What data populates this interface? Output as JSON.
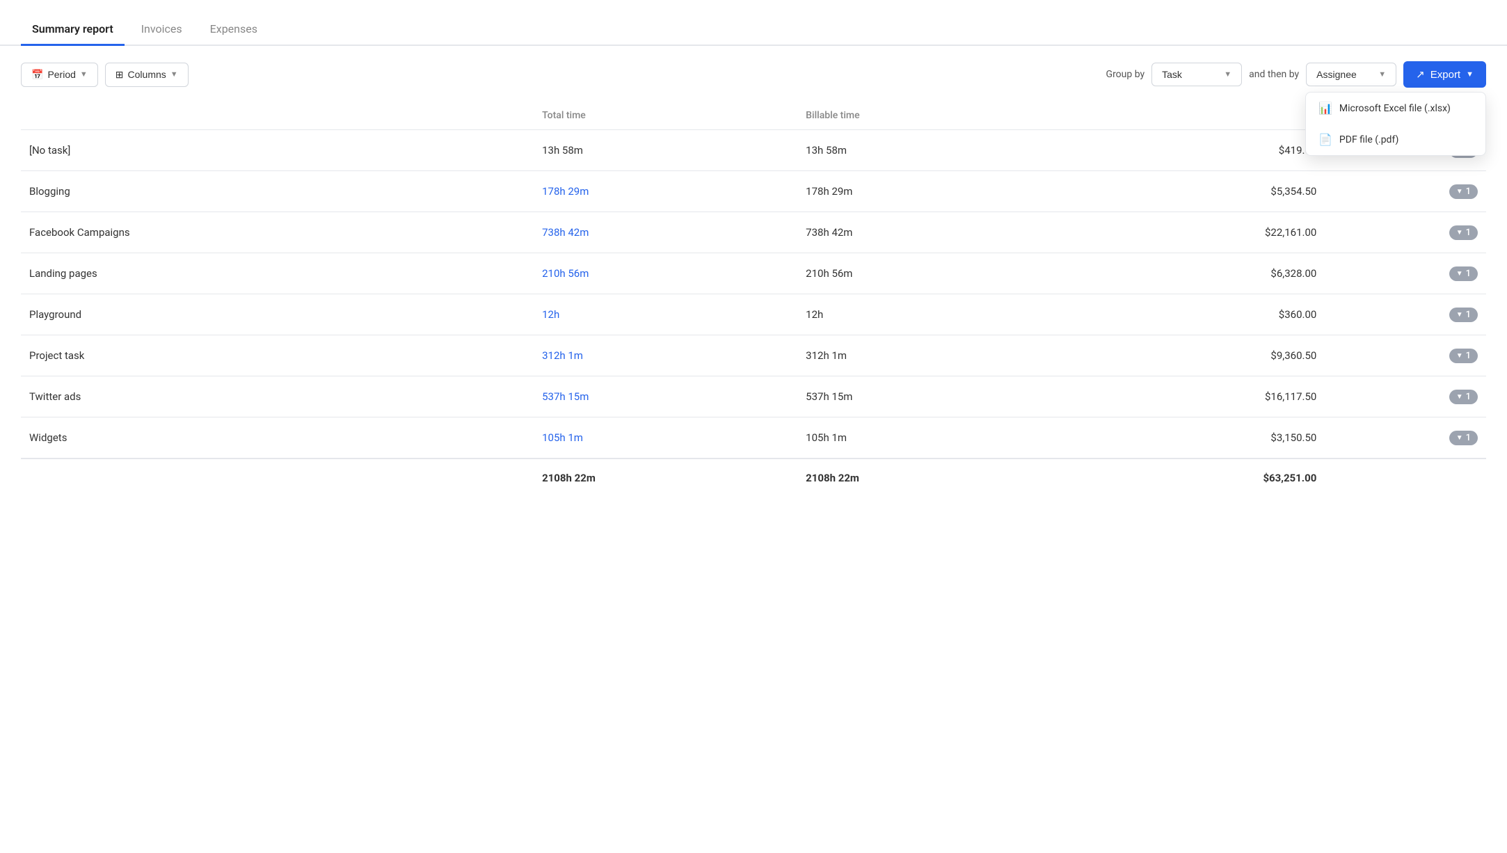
{
  "tabs": [
    {
      "id": "summary",
      "label": "Summary report",
      "active": true
    },
    {
      "id": "invoices",
      "label": "Invoices",
      "active": false
    },
    {
      "id": "expenses",
      "label": "Expenses",
      "active": false
    }
  ],
  "toolbar": {
    "period_label": "Period",
    "columns_label": "Columns",
    "group_by_label": "Group by",
    "group_by_value": "Task",
    "and_then_by_label": "and then by",
    "and_then_by_value": "Assignee",
    "export_label": "Export"
  },
  "export_dropdown": {
    "items": [
      {
        "id": "excel",
        "icon": "📊",
        "label": "Microsoft Excel file (.xlsx)"
      },
      {
        "id": "pdf",
        "icon": "📄",
        "label": "PDF file (.pdf)"
      }
    ]
  },
  "table": {
    "headers": [
      {
        "id": "name",
        "label": "",
        "align": "left"
      },
      {
        "id": "total_time",
        "label": "Total time",
        "align": "left"
      },
      {
        "id": "billable_time",
        "label": "Billable time",
        "align": "left"
      },
      {
        "id": "amount",
        "label": "",
        "align": "right"
      },
      {
        "id": "expand",
        "label": "",
        "align": "right"
      }
    ],
    "rows": [
      {
        "name": "[No task]",
        "total_time": "13h 58m",
        "total_blue": false,
        "billable_time": "13h 58m",
        "amount": "$419.00",
        "badge": "1"
      },
      {
        "name": "Blogging",
        "total_time": "178h 29m",
        "total_blue": true,
        "billable_time": "178h 29m",
        "amount": "$5,354.50",
        "badge": "1"
      },
      {
        "name": "Facebook Campaigns",
        "total_time": "738h 42m",
        "total_blue": true,
        "billable_time": "738h 42m",
        "amount": "$22,161.00",
        "badge": "1"
      },
      {
        "name": "Landing pages",
        "total_time": "210h 56m",
        "total_blue": true,
        "billable_time": "210h 56m",
        "amount": "$6,328.00",
        "badge": "1"
      },
      {
        "name": "Playground",
        "total_time": "12h",
        "total_blue": true,
        "billable_time": "12h",
        "amount": "$360.00",
        "badge": "1"
      },
      {
        "name": "Project task",
        "total_time": "312h 1m",
        "total_blue": true,
        "billable_time": "312h 1m",
        "amount": "$9,360.50",
        "badge": "1"
      },
      {
        "name": "Twitter ads",
        "total_time": "537h 15m",
        "total_blue": true,
        "billable_time": "537h 15m",
        "amount": "$16,117.50",
        "badge": "1"
      },
      {
        "name": "Widgets",
        "total_time": "105h 1m",
        "total_blue": true,
        "billable_time": "105h 1m",
        "amount": "$3,150.50",
        "badge": "1"
      }
    ],
    "footer": {
      "total_time": "2108h 22m",
      "billable_time": "2108h 22m",
      "amount": "$63,251.00"
    }
  }
}
